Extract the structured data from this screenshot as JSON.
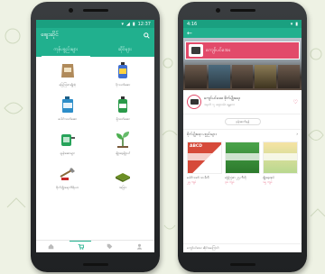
{
  "colors": {
    "accent": "#21b08e",
    "status_bar": "#1aa080",
    "shop_brand": "#e24a6a"
  },
  "left_phone": {
    "status": {
      "time": "12:37"
    },
    "appbar": {
      "title": "ဈေးဆိုင်",
      "search_icon": "search-icon"
    },
    "tabs": [
      {
        "label": "ကုန်ပစ္စည်းများ",
        "active": true
      },
      {
        "label": "ဆိုင်များ",
        "active": false
      }
    ],
    "categories": [
      {
        "label": "မြေဩဇာမျိုးစုံ",
        "icon": "fertilizer-bag-icon"
      },
      {
        "label": "ပိုးသတ်ဆေး",
        "icon": "pesticide-bottle-icon"
      },
      {
        "label": "ပေါင်းသတ်ဆေး",
        "icon": "herbicide-can-icon"
      },
      {
        "label": "မှိုသတ်ဆေး",
        "icon": "fungicide-bottle-icon"
      },
      {
        "label": "ဖျန်းဆေးများ",
        "icon": "sprayer-tank-icon"
      },
      {
        "label": "မျိုးစေ့မျိုးပင်",
        "icon": "seedling-icon"
      },
      {
        "label": "စိုက်ပျိုးရေးကိရိယာ",
        "icon": "farm-tool-icon"
      },
      {
        "label": "အခြား",
        "icon": "other-package-icon"
      }
    ],
    "bottom_nav": [
      {
        "icon": "home-icon",
        "active": false
      },
      {
        "icon": "cart-icon",
        "active": true
      },
      {
        "icon": "tag-icon",
        "active": false
      },
      {
        "icon": "profile-icon",
        "active": false
      }
    ]
  },
  "right_phone": {
    "status": {
      "time": "4:16"
    },
    "shop_sign": "ကျော်ပင်အေး",
    "shop": {
      "name": "ကျော်ပင်အေး စိုက်ပျိုးရေး",
      "address": "အမှတ် ၁၂ ဈေးလမ်း၊ မန္တလေး",
      "follow_label": "ဖုန်းဆက်ရန်"
    },
    "section": {
      "title": "စိုက်ပျိုးရေး ပစ္စည်းများ",
      "more": "›"
    },
    "products": [
      {
        "brand": "ABCD",
        "name": "ပေါင်းသတ် ၁၀ မီလီ",
        "price": "၂၅ ကျပ်"
      },
      {
        "brand": "",
        "name": "မြေဩဇာ ၂၅ ကီလို",
        "price": "၃၀ ကျပ်"
      },
      {
        "brand": "",
        "name": "မျိုးစေ့ထုပ်",
        "price": "၁၅ ကျပ်"
      }
    ],
    "bottom_text": "ကျော်ပင်အေး ဆိုင်အကြောင်း"
  }
}
